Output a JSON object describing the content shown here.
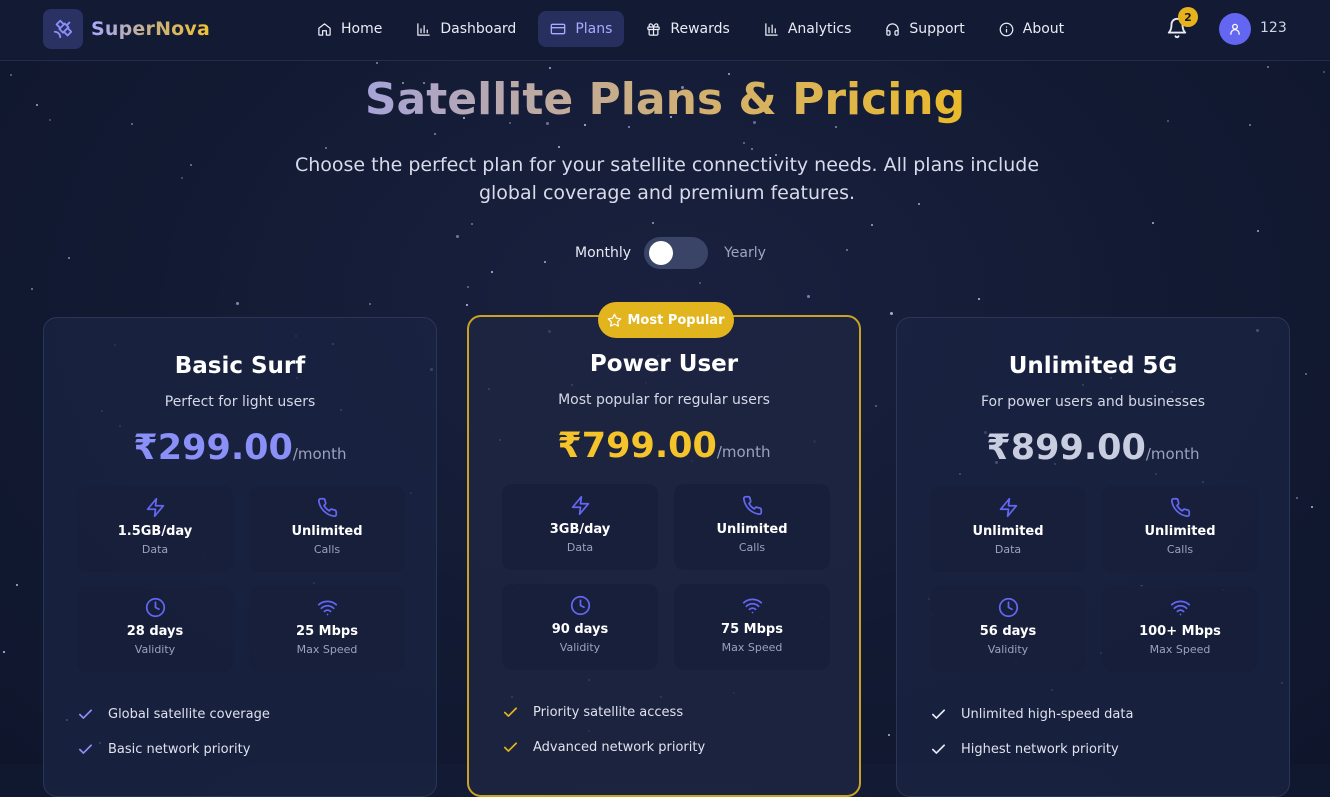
{
  "brand": {
    "name": "SuperNova",
    "icon": "satellite-icon"
  },
  "nav": [
    {
      "label": "Home",
      "icon": "home-icon"
    },
    {
      "label": "Dashboard",
      "icon": "bar-chart-icon"
    },
    {
      "label": "Plans",
      "icon": "credit-card-icon",
      "active": true
    },
    {
      "label": "Rewards",
      "icon": "gift-icon"
    },
    {
      "label": "Analytics",
      "icon": "bar-chart-icon"
    },
    {
      "label": "Support",
      "icon": "headphones-icon"
    },
    {
      "label": "About",
      "icon": "info-icon"
    }
  ],
  "notifications": {
    "count": "2",
    "icon": "bell-icon"
  },
  "user": {
    "name": "123",
    "icon": "user-icon"
  },
  "hero": {
    "title": "Satellite Plans & Pricing",
    "subtitle": "Choose the perfect plan for your satellite connectivity needs. All plans include global coverage and premium features."
  },
  "billing": {
    "monthly_label": "Monthly",
    "yearly_label": "Yearly",
    "selected": "Monthly"
  },
  "popular_badge": "Most Popular",
  "colors": {
    "accent": "#6366f1",
    "gold": "#e2b41d",
    "price_basic": "#8b8ff8",
    "price_power": "#f5c32a",
    "price_unlimited": "#c9cde0"
  },
  "plans": [
    {
      "name": "Basic Surf",
      "description": "Perfect for light users",
      "price": "₹299.00",
      "period": "/month",
      "stats": [
        {
          "value": "1.5GB/day",
          "label": "Data",
          "icon": "zap-icon"
        },
        {
          "value": "Unlimited",
          "label": "Calls",
          "icon": "phone-icon"
        },
        {
          "value": "28 days",
          "label": "Validity",
          "icon": "clock-icon"
        },
        {
          "value": "25 Mbps",
          "label": "Max Speed",
          "icon": "wifi-icon"
        }
      ],
      "features": [
        "Global satellite coverage",
        "Basic network priority"
      ]
    },
    {
      "name": "Power User",
      "description": "Most popular for regular users",
      "price": "₹799.00",
      "period": "/month",
      "stats": [
        {
          "value": "3GB/day",
          "label": "Data",
          "icon": "zap-icon"
        },
        {
          "value": "Unlimited",
          "label": "Calls",
          "icon": "phone-icon"
        },
        {
          "value": "90 days",
          "label": "Validity",
          "icon": "clock-icon"
        },
        {
          "value": "75 Mbps",
          "label": "Max Speed",
          "icon": "wifi-icon"
        }
      ],
      "features": [
        "Priority satellite access",
        "Advanced network priority"
      ]
    },
    {
      "name": "Unlimited 5G",
      "description": "For power users and businesses",
      "price": "₹899.00",
      "period": "/month",
      "stats": [
        {
          "value": "Unlimited",
          "label": "Data",
          "icon": "zap-icon"
        },
        {
          "value": "Unlimited",
          "label": "Calls",
          "icon": "phone-icon"
        },
        {
          "value": "56 days",
          "label": "Validity",
          "icon": "clock-icon"
        },
        {
          "value": "100+ Mbps",
          "label": "Max Speed",
          "icon": "wifi-icon"
        }
      ],
      "features": [
        "Unlimited high-speed data",
        "Highest network priority"
      ]
    }
  ]
}
